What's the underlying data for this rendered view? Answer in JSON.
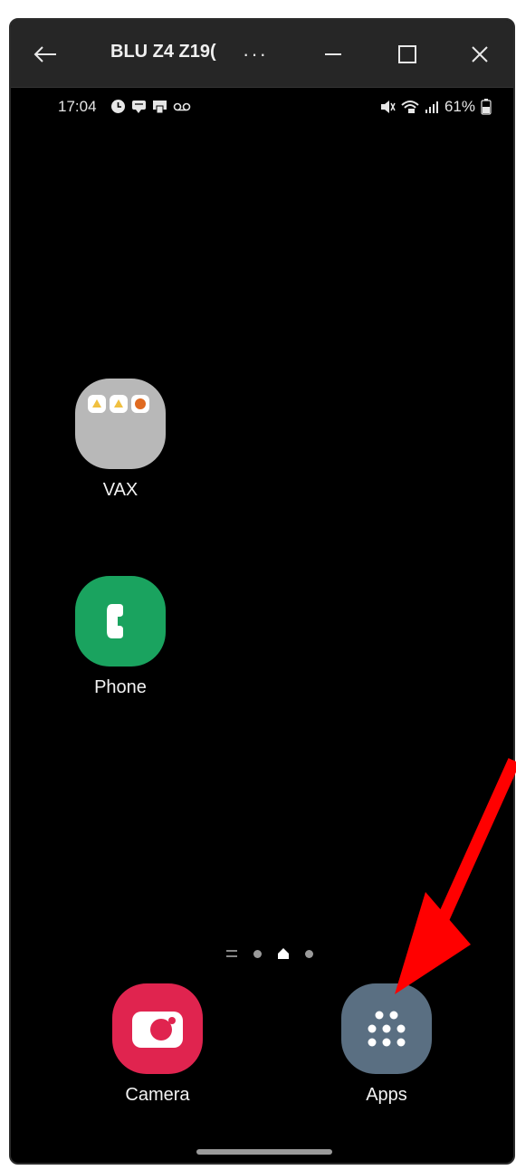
{
  "window": {
    "title": "BLU Z4 Z19(",
    "more_label": "···"
  },
  "status_bar": {
    "time": "17:04",
    "battery": "61%"
  },
  "home_apps": [
    {
      "label": "VAX",
      "icon": "folder-icon"
    },
    {
      "label": "Phone",
      "icon": "phone-icon",
      "color": "#1aa35f"
    }
  ],
  "dock": [
    {
      "label": "Camera",
      "icon": "camera-icon",
      "color": "#e0244f"
    },
    {
      "label": "Apps",
      "icon": "apps-grid-icon",
      "color": "#5a6f82"
    }
  ],
  "page_indicator": {
    "pages": 3,
    "current": 2
  },
  "annotation": {
    "type": "arrow",
    "color": "#ff0000",
    "target": "Apps"
  }
}
